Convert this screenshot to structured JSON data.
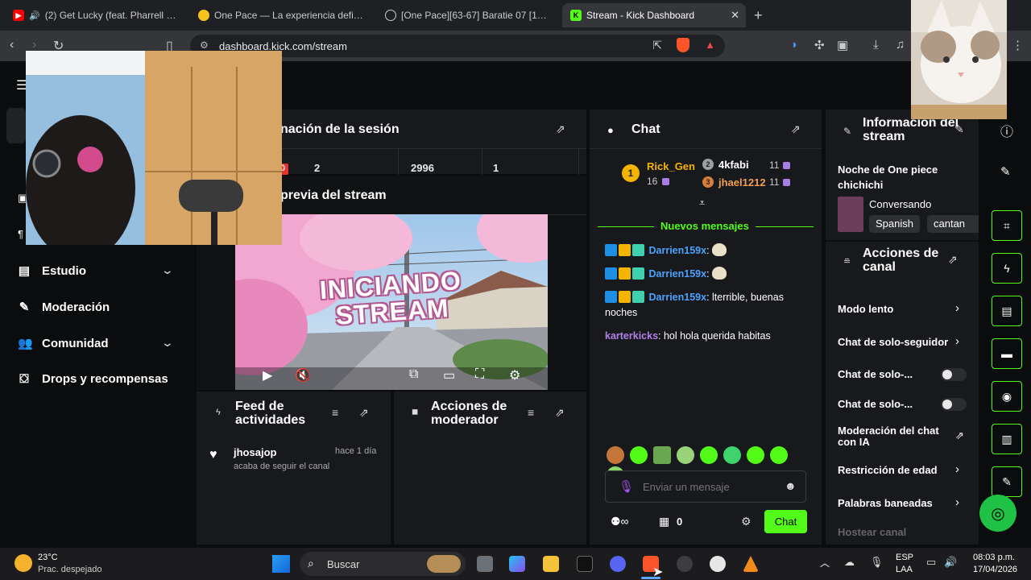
{
  "tabs": [
    {
      "title": "(2) Get Lucky (feat. Pharrell Willia",
      "favicon": "youtube-icon",
      "audio": "speaker-icon"
    },
    {
      "title": "One Pace — La experiencia definitiva",
      "favicon": "one-pace-icon"
    },
    {
      "title": "[One Pace][63-67] Baratie 07 [1080p]",
      "favicon": "globe-icon"
    },
    {
      "title": "Stream - Kick Dashboard",
      "favicon": "kick-icon"
    }
  ],
  "address": {
    "url": "dashboard.kick.com/stream"
  },
  "session": {
    "title_partial": "nación de la sesión",
    "stats": [
      "0",
      "2",
      "2996",
      "1"
    ]
  },
  "preview": {
    "title_partial": "previa del stream",
    "overlay_text": [
      "INICIANDO",
      "STREAM"
    ]
  },
  "sidebar": {
    "items": [
      {
        "label": "Estudio",
        "icon": "studio-icon",
        "has_chevron": true
      },
      {
        "label": "Moderación",
        "icon": "wrench-icon",
        "has_chevron": false
      },
      {
        "label": "Comunidad",
        "icon": "community-icon",
        "has_chevron": true
      },
      {
        "label": "Drops y recompensas",
        "icon": "drops-icon",
        "has_chevron": false
      }
    ]
  },
  "feed": {
    "title": "Feed de actividades",
    "items": [
      {
        "user": "jhosajop",
        "time": "hace 1 día",
        "action": "acaba de seguir el canal"
      }
    ]
  },
  "mod_actions": {
    "title": "Acciones de moderador"
  },
  "chat": {
    "title": "Chat",
    "leaders": [
      {
        "rank": "1",
        "name": "Rick_Gen",
        "count": "16"
      },
      {
        "rank": "2",
        "name": "4kfabi",
        "count": "11"
      },
      {
        "rank": "3",
        "name": "jhael1212",
        "count": "11"
      }
    ],
    "new_messages_label": "Nuevos mensajes",
    "messages": [
      {
        "user": "Darrien159x",
        "text": ""
      },
      {
        "user": "Darrien159x",
        "text": ""
      },
      {
        "user": "Darrien159x",
        "text": "lterrible, buenas noches"
      },
      {
        "user": "karterkicks",
        "text": "hol hola querida habitas"
      }
    ],
    "input_placeholder": "Enviar un mensaje",
    "viewer_count": "0",
    "send_label": "Chat"
  },
  "stream_info": {
    "title": "Información del stream",
    "stream_title": "Noche de One piece chichichi",
    "category": "Conversando",
    "tags": [
      "Spanish",
      "cantan"
    ]
  },
  "channel_actions": {
    "title": "Acciones de canal",
    "rows": [
      {
        "label": "Modo lento",
        "control": "chevron"
      },
      {
        "label": "Chat de solo-seguidor",
        "control": "chevron"
      },
      {
        "label": "Chat de solo-...",
        "control": "toggle",
        "on": false
      },
      {
        "label": "Chat de solo-...",
        "control": "toggle",
        "on": false
      },
      {
        "label": "Moderación del chat con IA",
        "control": "external"
      },
      {
        "label": "Restricción de edad",
        "control": "chevron"
      },
      {
        "label": "Palabras baneadas",
        "control": "chevron"
      },
      {
        "label": "Hostear canal",
        "control": "none"
      }
    ]
  },
  "taskbar": {
    "weather_temp": "23°C",
    "weather_desc": "Prac. despejado",
    "search_label": "Buscar",
    "lang": "ESP",
    "region": "LAA",
    "time": "08:03 p.m.",
    "date": "17/04/2026"
  },
  "colors": {
    "accent": "#53fc18",
    "panel": "#18191c",
    "bg": "#0b0c0d",
    "link_blue": "#4aa3ff",
    "purple": "#b37feb"
  }
}
